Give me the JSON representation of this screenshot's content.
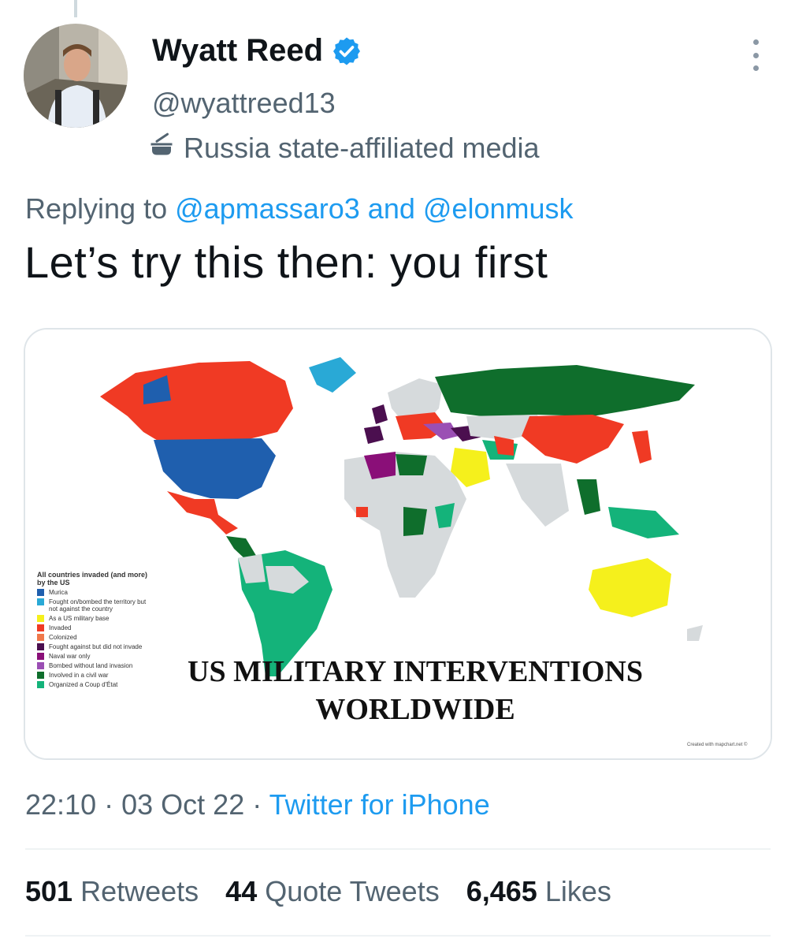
{
  "author": {
    "name": "Wyatt Reed",
    "handle": "@wyattreed13",
    "affiliation": "Russia state-affiliated media"
  },
  "reply": {
    "prefix": "Replying to",
    "mention1": "@apmassaro3",
    "joiner": "and",
    "mention2": "@elonmusk"
  },
  "tweet_text": "Let’s try this then: you first",
  "image": {
    "title_line1": "US MILITARY INTERVENTIONS",
    "title_line2": "WORLDWIDE",
    "legend_title": "All countries invaded (and more) by the US",
    "legend": [
      {
        "label": "Murica",
        "color": "#1f5fae"
      },
      {
        "label": "Fought on/bombed the territory but not against the country",
        "color": "#29a9d6"
      },
      {
        "label": "As a US military base",
        "color": "#f5f01c"
      },
      {
        "label": "Invaded",
        "color": "#f03a24"
      },
      {
        "label": "Colonized",
        "color": "#f0784a"
      },
      {
        "label": "Fought against but did not invade",
        "color": "#4b0f4f"
      },
      {
        "label": "Naval war only",
        "color": "#8a0f78"
      },
      {
        "label": "Bombed without land invasion",
        "color": "#9b4fb4"
      },
      {
        "label": "Involved in a civil war",
        "color": "#0f6e2c"
      },
      {
        "label": "Organized a Coup d'État",
        "color": "#14b37a"
      }
    ],
    "credit": "Created with mapchart.net ©"
  },
  "meta": {
    "time": "22:10",
    "date": "03 Oct 22",
    "source": "Twitter for iPhone"
  },
  "stats": {
    "retweets_count": "501",
    "retweets_label": "Retweets",
    "quotes_count": "44",
    "quotes_label": "Quote Tweets",
    "likes_count": "6,465",
    "likes_label": "Likes"
  },
  "colors": {
    "accent": "#1d9bf0",
    "secondary_text": "#536471"
  }
}
